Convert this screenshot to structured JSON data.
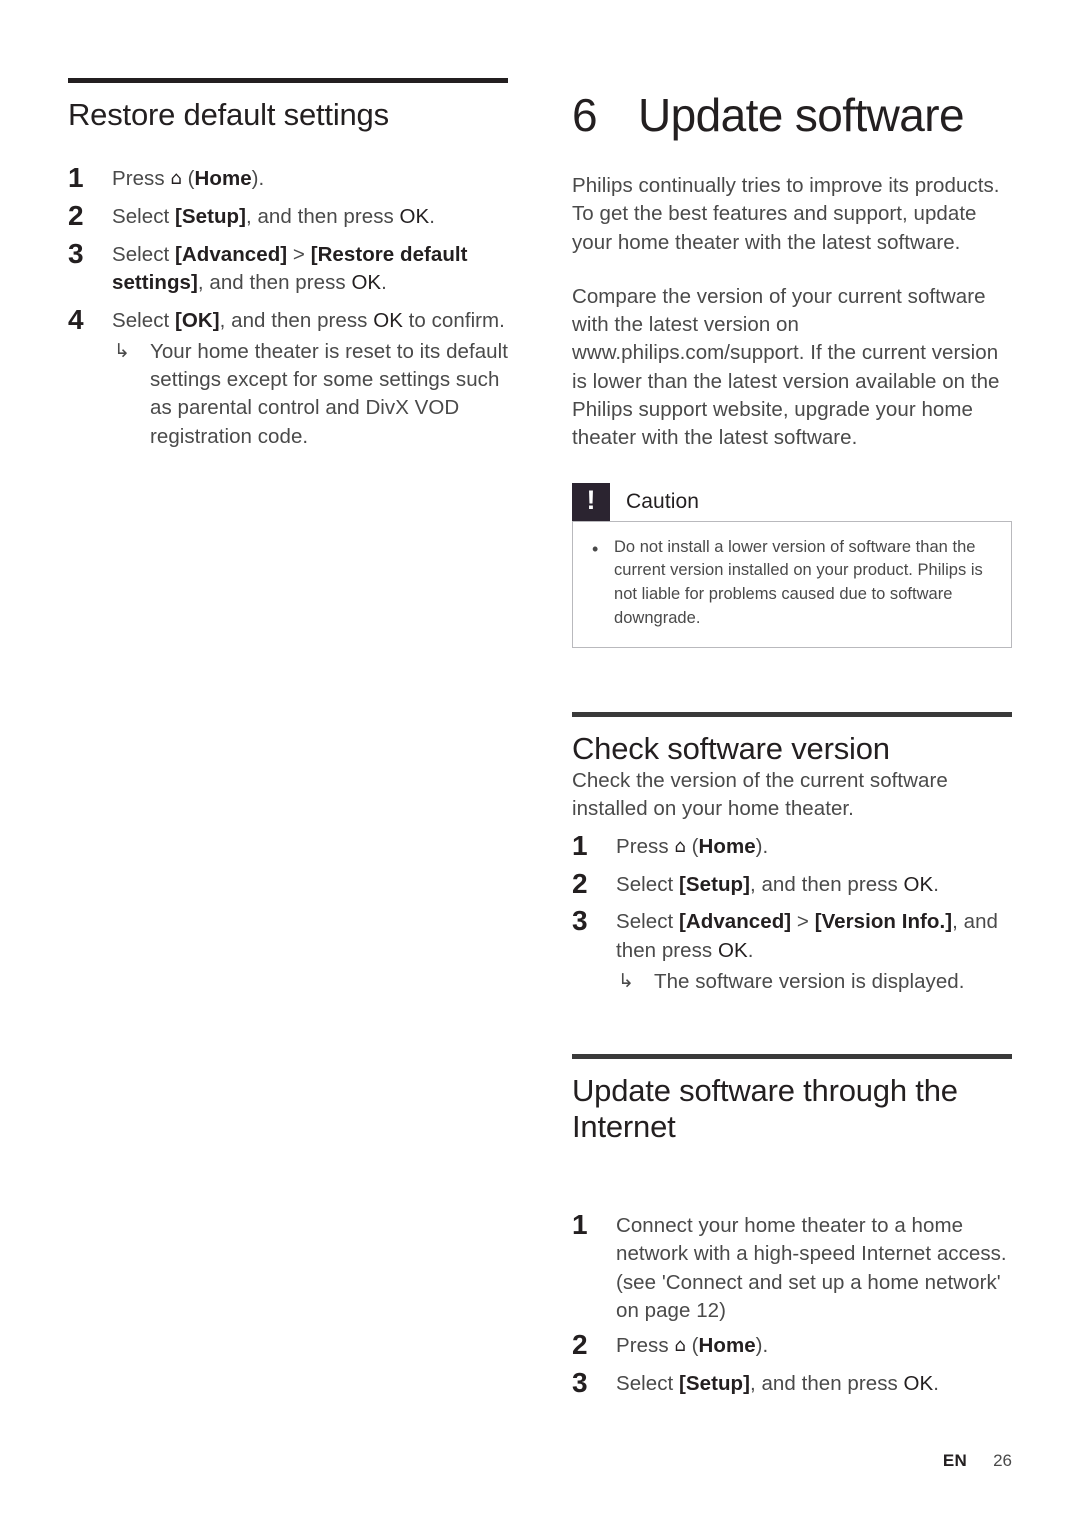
{
  "document": {
    "language_code": "EN",
    "page_number": "26",
    "home_glyph": "⌂",
    "arrow_glyph": "↳",
    "bullet_glyph": "•",
    "caution_mark": "!"
  },
  "left_column": {
    "heading": "Restore default settings",
    "steps": [
      {
        "number": "1",
        "parts": [
          {
            "text": "Press ",
            "style": "normal"
          },
          {
            "text": "HOME_ICON",
            "style": "icon"
          },
          {
            "text": " (",
            "style": "normal"
          },
          {
            "text": "Home",
            "style": "bold"
          },
          {
            "text": ").",
            "style": "normal"
          }
        ],
        "plain": "Press ⌂ (Home)."
      },
      {
        "number": "2",
        "plain": "Select [Setup], and then press OK."
      },
      {
        "number": "3",
        "plain": "Select [Advanced] > [Restore default settings], and then press OK."
      },
      {
        "number": "4",
        "plain": "Select [OK], and then press OK to confirm.",
        "substeps": [
          "Your home theater is reset to its default settings except for some settings such as parental control and DivX VOD registration code."
        ]
      }
    ]
  },
  "right_column": {
    "chapter": {
      "number": "6",
      "title": "Update software"
    },
    "intro_paragraphs": [
      "Philips continually tries to improve its products. To get the best features and support, update your home theater with the latest software.",
      "Compare the version of your current software with the latest version on www.philips.com/support. If the current version is lower than the latest version available on the Philips support website, upgrade your home theater with the latest software."
    ],
    "caution": {
      "title": "Caution",
      "items": [
        "Do not install a lower version of software than the current version installed on your product. Philips is not liable for problems caused due to software downgrade."
      ]
    },
    "sections": [
      {
        "heading": "Check software version",
        "intro": "Check the version of the current software installed on your home theater.",
        "steps": [
          {
            "number": "1",
            "plain": "Press ⌂ (Home)."
          },
          {
            "number": "2",
            "plain": "Select [Setup], and then press OK."
          },
          {
            "number": "3",
            "plain": "Select [Advanced] > [Version Info.], and then press OK.",
            "substeps": [
              "The software version is displayed."
            ]
          }
        ]
      },
      {
        "heading": "Update software through the Internet",
        "steps": [
          {
            "number": "1",
            "plain": "Connect your home theater to a home network with a high-speed Internet access. (see 'Connect and set up a home network' on page 12)"
          },
          {
            "number": "2",
            "plain": "Press ⌂ (Home)."
          },
          {
            "number": "3",
            "plain": "Select [Setup], and then press OK."
          }
        ]
      }
    ]
  },
  "colors": {
    "text_dark": "#231f20",
    "text_body": "#4a4a4a",
    "rule": "#231f20",
    "note_icon_bg": "#2b2430",
    "note_border": "#b9b9bd"
  }
}
